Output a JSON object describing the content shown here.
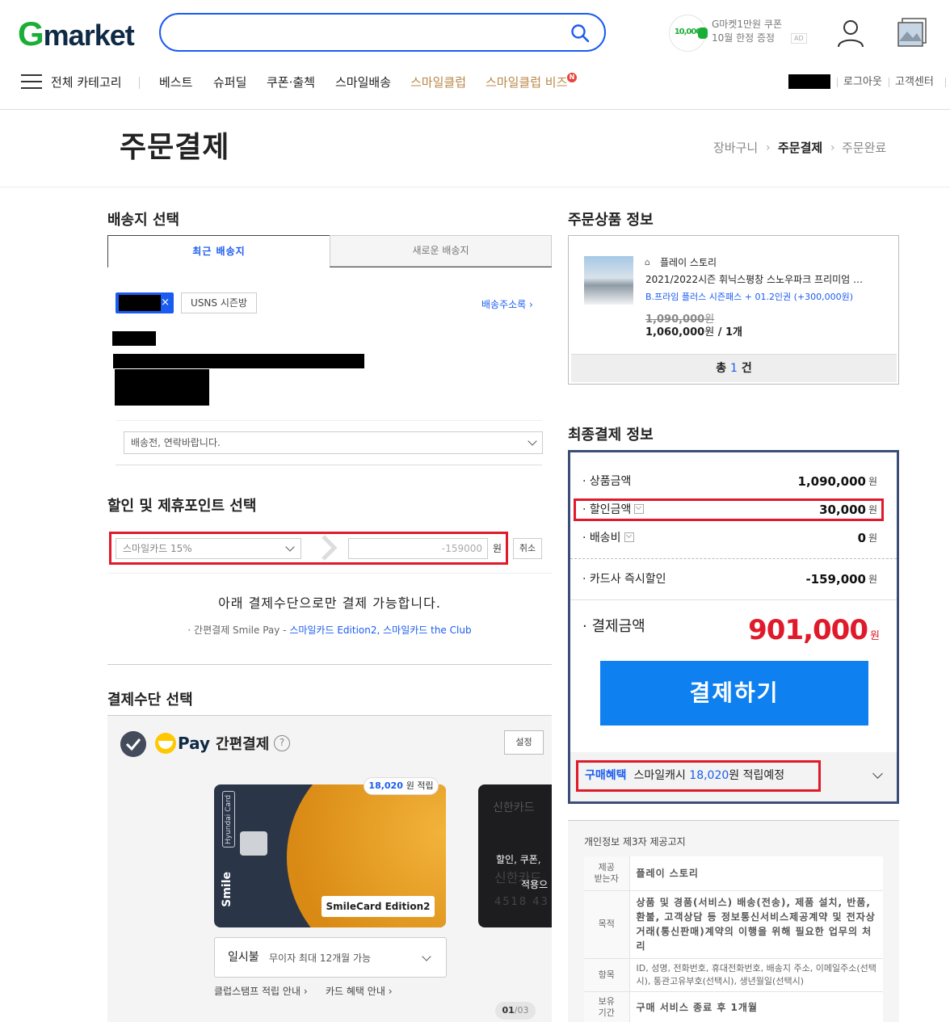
{
  "header": {
    "logo": {
      "g": "G",
      "rest": "market"
    },
    "search": {
      "placeholder": ""
    },
    "ad": {
      "badge": "10,000",
      "line1": "G마켓1만원 쿠폰",
      "line2": "10월 한정 증정",
      "label": "AD"
    },
    "nav": {
      "all_categories": "전체 카테고리",
      "items": [
        "베스트",
        "슈퍼딜",
        "쿠폰·출첵",
        "스마일배송",
        "스마일클럽",
        "스마일클럽 비즈"
      ],
      "new_badge": "N"
    },
    "util": {
      "logout": "로그아웃",
      "customer_center": "고객센터"
    }
  },
  "page": {
    "title": "주문결제",
    "breadcrumb": [
      "장바구니",
      "주문결제",
      "주문완료"
    ]
  },
  "shipping": {
    "title": "배송지 선택",
    "tabs": [
      "최근 배송지",
      "새로운 배송지"
    ],
    "chip_close": "×",
    "chip_usns": "USNS 시즌방",
    "address_book": "배송주소록",
    "memo": "배송전, 연락바랍니다."
  },
  "discount": {
    "title": "할인 및 제휴포인트 선택",
    "card_option": "스마일카드 15%",
    "amount": "-159000",
    "won": "원",
    "cancel": "취소",
    "notice": "아래 결제수단으로만 결제 가능합니다.",
    "sub_prefix": "· 간편결제 Smile Pay - ",
    "sub_cards": "스마일카드 Edition2, 스마일카드 the Club"
  },
  "payment_method": {
    "title": "결제수단 선택",
    "pay_brand": "Pay",
    "pay_label": "간편결제",
    "help": "?",
    "setting": "설정",
    "card1": {
      "name": "SmileCard Edition2",
      "reward_value": "18,020",
      "reward_suffix": "원 적립",
      "issuer_vertical": "Hyundai Card",
      "smile": "Smile"
    },
    "card2": {
      "brand": "신한카드",
      "line1": "할인, 쿠폰,",
      "line2": "신한카드",
      "line3": "적용으",
      "number": "4518 43"
    },
    "installment": {
      "type": "일시불",
      "desc": "무이자 최대 12개월 가능"
    },
    "links": [
      "클럽스탬프 적립 안내",
      "카드 혜택 안내"
    ],
    "pager": {
      "current": "01",
      "total": "/03"
    }
  },
  "order_product": {
    "title": "주문상품 정보",
    "seller": "플레이 스토리",
    "name": "2021/2022시즌 휘닉스평창 스노우파크 프리미엄 …",
    "option": "B.프라임 플러스 시즌패스 + 01.2인권 (+300,000원)",
    "orig_price": "1,090,000",
    "price": "1,060,000",
    "qty": "/ 1개",
    "won": "원",
    "total_prefix": "총",
    "total_count": "1",
    "total_suffix": "건"
  },
  "final_payment": {
    "title": "최종결제 정보",
    "rows": [
      {
        "label": "· 상품금액",
        "value": "1,090,000"
      },
      {
        "label": "· 할인금액",
        "value": "30,000"
      },
      {
        "label": "· 배송비",
        "value": "0"
      },
      {
        "label": "· 카드사 즉시할인",
        "value": "-159,000"
      }
    ],
    "won": "원",
    "total_label": "· 결제금액",
    "total_value": "901,000",
    "pay_button": "결제하기",
    "benefit": {
      "label": "구매혜택",
      "text": "스마일캐시",
      "value": "18,020",
      "suffix": "원 적립예정"
    }
  },
  "privacy": {
    "title": "개인정보 제3자 제공고지",
    "rows": [
      {
        "head": "제공\n받는자",
        "value": "플레이 스토리"
      },
      {
        "head": "목적",
        "value": "상품 및 경품(서비스) 배송(전송), 제품 설치, 반품, 환불, 고객상담 등 정보통신서비스제공계약 및 전자상거래(통신판매)계약의 이행을 위해 필요한 업무의 처리"
      },
      {
        "head": "항목",
        "value": "ID, 성명, 전화번호, 휴대전화번호, 배송지 주소, 이메일주소(선택시), 통관고유부호(선택시), 생년월일(선택시)"
      },
      {
        "head": "보유\n기간",
        "value": "구매 서비스 종료 후 1개월"
      }
    ]
  },
  "colors": {
    "accent_blue": "#1a5cf0",
    "pay_button": "#0e80f0",
    "highlight_red": "#e01a2a",
    "brand_green": "#1bae37",
    "gold": "#b88746"
  }
}
